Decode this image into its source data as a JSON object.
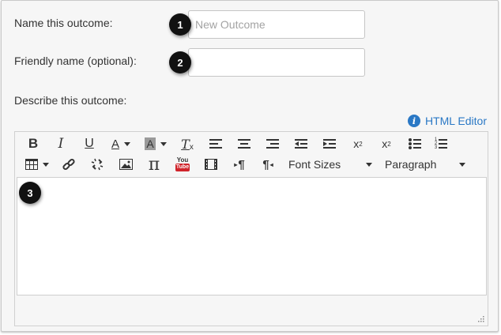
{
  "form": {
    "name_label": "Name this outcome:",
    "name_placeholder": "New Outcome",
    "name_value": "",
    "friendly_label": "Friendly name (optional):",
    "friendly_value": "",
    "describe_label": "Describe this outcome:",
    "html_editor_link": "HTML Editor",
    "info_icon_glyph": "i"
  },
  "markers": [
    "1",
    "2",
    "3"
  ],
  "toolbar": {
    "row1": [
      "bold-icon",
      "italic-icon",
      "underline-icon",
      "text-color-icon",
      "background-color-icon",
      "clear-formatting-icon",
      "align-left-icon",
      "align-center-icon",
      "align-right-icon",
      "outdent-icon",
      "indent-icon",
      "superscript-icon",
      "subscript-icon",
      "bullet-list-icon",
      "numbered-list-icon"
    ],
    "row2": [
      "table-icon",
      "link-icon",
      "unlink-icon",
      "image-icon",
      "equation-icon",
      "youtube-icon",
      "media-icon",
      "ltr-icon",
      "rtl-icon"
    ],
    "glyphs": {
      "bold": "B",
      "italic": "I",
      "underline": "U",
      "text_color": "A",
      "bg_color": "A",
      "clear_format": "T",
      "clear_x": "x",
      "equation": "π",
      "youtube_top": "You",
      "youtube_bottom": "Tube",
      "ltr": "¶",
      "rtl": "¶",
      "sup": "x",
      "sup_mark": "2",
      "sub": "x",
      "sub_mark": "2",
      "num1": "1",
      "num2": "2",
      "num3": "3"
    },
    "font_sizes_label": "Font Sizes",
    "paragraph_label": "Paragraph"
  },
  "colors": {
    "accent": "#2a78c5",
    "marker": "#111111"
  }
}
